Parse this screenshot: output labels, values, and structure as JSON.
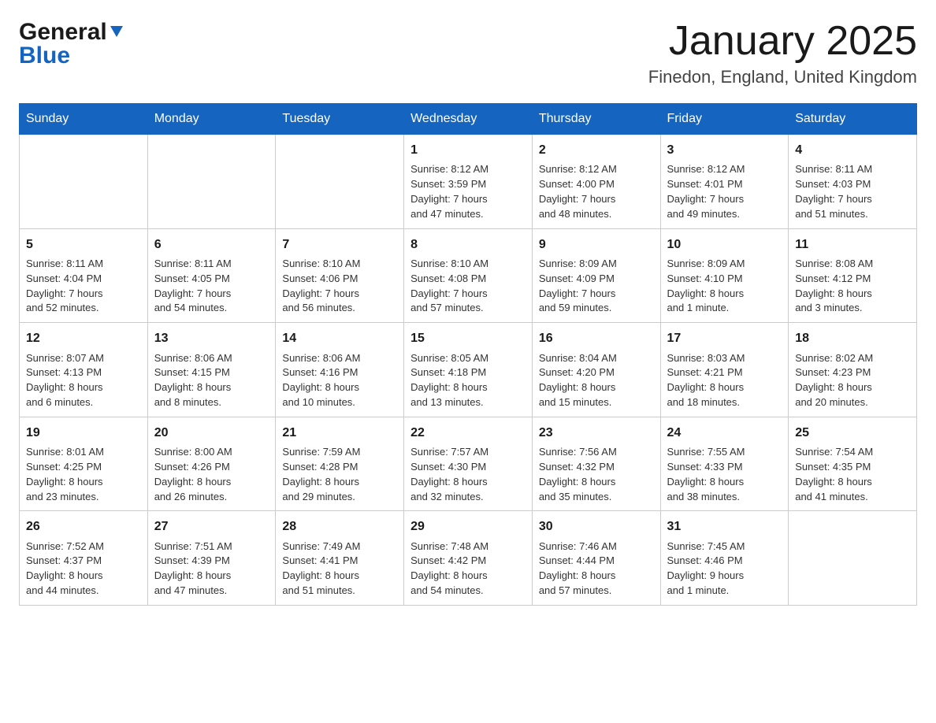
{
  "header": {
    "logo_general": "General",
    "logo_blue": "Blue",
    "title": "January 2025",
    "subtitle": "Finedon, England, United Kingdom"
  },
  "calendar": {
    "days_of_week": [
      "Sunday",
      "Monday",
      "Tuesday",
      "Wednesday",
      "Thursday",
      "Friday",
      "Saturday"
    ],
    "weeks": [
      [
        {
          "day": "",
          "info": ""
        },
        {
          "day": "",
          "info": ""
        },
        {
          "day": "",
          "info": ""
        },
        {
          "day": "1",
          "info": "Sunrise: 8:12 AM\nSunset: 3:59 PM\nDaylight: 7 hours\nand 47 minutes."
        },
        {
          "day": "2",
          "info": "Sunrise: 8:12 AM\nSunset: 4:00 PM\nDaylight: 7 hours\nand 48 minutes."
        },
        {
          "day": "3",
          "info": "Sunrise: 8:12 AM\nSunset: 4:01 PM\nDaylight: 7 hours\nand 49 minutes."
        },
        {
          "day": "4",
          "info": "Sunrise: 8:11 AM\nSunset: 4:03 PM\nDaylight: 7 hours\nand 51 minutes."
        }
      ],
      [
        {
          "day": "5",
          "info": "Sunrise: 8:11 AM\nSunset: 4:04 PM\nDaylight: 7 hours\nand 52 minutes."
        },
        {
          "day": "6",
          "info": "Sunrise: 8:11 AM\nSunset: 4:05 PM\nDaylight: 7 hours\nand 54 minutes."
        },
        {
          "day": "7",
          "info": "Sunrise: 8:10 AM\nSunset: 4:06 PM\nDaylight: 7 hours\nand 56 minutes."
        },
        {
          "day": "8",
          "info": "Sunrise: 8:10 AM\nSunset: 4:08 PM\nDaylight: 7 hours\nand 57 minutes."
        },
        {
          "day": "9",
          "info": "Sunrise: 8:09 AM\nSunset: 4:09 PM\nDaylight: 7 hours\nand 59 minutes."
        },
        {
          "day": "10",
          "info": "Sunrise: 8:09 AM\nSunset: 4:10 PM\nDaylight: 8 hours\nand 1 minute."
        },
        {
          "day": "11",
          "info": "Sunrise: 8:08 AM\nSunset: 4:12 PM\nDaylight: 8 hours\nand 3 minutes."
        }
      ],
      [
        {
          "day": "12",
          "info": "Sunrise: 8:07 AM\nSunset: 4:13 PM\nDaylight: 8 hours\nand 6 minutes."
        },
        {
          "day": "13",
          "info": "Sunrise: 8:06 AM\nSunset: 4:15 PM\nDaylight: 8 hours\nand 8 minutes."
        },
        {
          "day": "14",
          "info": "Sunrise: 8:06 AM\nSunset: 4:16 PM\nDaylight: 8 hours\nand 10 minutes."
        },
        {
          "day": "15",
          "info": "Sunrise: 8:05 AM\nSunset: 4:18 PM\nDaylight: 8 hours\nand 13 minutes."
        },
        {
          "day": "16",
          "info": "Sunrise: 8:04 AM\nSunset: 4:20 PM\nDaylight: 8 hours\nand 15 minutes."
        },
        {
          "day": "17",
          "info": "Sunrise: 8:03 AM\nSunset: 4:21 PM\nDaylight: 8 hours\nand 18 minutes."
        },
        {
          "day": "18",
          "info": "Sunrise: 8:02 AM\nSunset: 4:23 PM\nDaylight: 8 hours\nand 20 minutes."
        }
      ],
      [
        {
          "day": "19",
          "info": "Sunrise: 8:01 AM\nSunset: 4:25 PM\nDaylight: 8 hours\nand 23 minutes."
        },
        {
          "day": "20",
          "info": "Sunrise: 8:00 AM\nSunset: 4:26 PM\nDaylight: 8 hours\nand 26 minutes."
        },
        {
          "day": "21",
          "info": "Sunrise: 7:59 AM\nSunset: 4:28 PM\nDaylight: 8 hours\nand 29 minutes."
        },
        {
          "day": "22",
          "info": "Sunrise: 7:57 AM\nSunset: 4:30 PM\nDaylight: 8 hours\nand 32 minutes."
        },
        {
          "day": "23",
          "info": "Sunrise: 7:56 AM\nSunset: 4:32 PM\nDaylight: 8 hours\nand 35 minutes."
        },
        {
          "day": "24",
          "info": "Sunrise: 7:55 AM\nSunset: 4:33 PM\nDaylight: 8 hours\nand 38 minutes."
        },
        {
          "day": "25",
          "info": "Sunrise: 7:54 AM\nSunset: 4:35 PM\nDaylight: 8 hours\nand 41 minutes."
        }
      ],
      [
        {
          "day": "26",
          "info": "Sunrise: 7:52 AM\nSunset: 4:37 PM\nDaylight: 8 hours\nand 44 minutes."
        },
        {
          "day": "27",
          "info": "Sunrise: 7:51 AM\nSunset: 4:39 PM\nDaylight: 8 hours\nand 47 minutes."
        },
        {
          "day": "28",
          "info": "Sunrise: 7:49 AM\nSunset: 4:41 PM\nDaylight: 8 hours\nand 51 minutes."
        },
        {
          "day": "29",
          "info": "Sunrise: 7:48 AM\nSunset: 4:42 PM\nDaylight: 8 hours\nand 54 minutes."
        },
        {
          "day": "30",
          "info": "Sunrise: 7:46 AM\nSunset: 4:44 PM\nDaylight: 8 hours\nand 57 minutes."
        },
        {
          "day": "31",
          "info": "Sunrise: 7:45 AM\nSunset: 4:46 PM\nDaylight: 9 hours\nand 1 minute."
        },
        {
          "day": "",
          "info": ""
        }
      ]
    ]
  }
}
